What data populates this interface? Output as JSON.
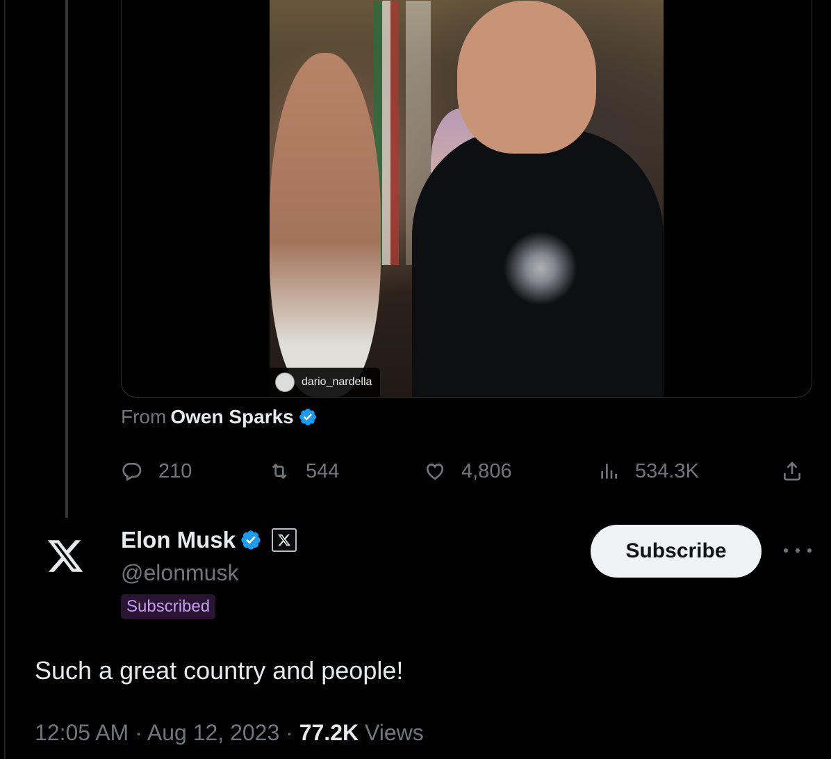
{
  "colors": {
    "background": "#000000",
    "text_primary": "#e7e9ea",
    "text_secondary": "#71767b",
    "verified_blue": "#1d9bf0",
    "subscribed_badge_text": "#c79bf2",
    "subscribed_badge_bg": "#2a1433",
    "subscribe_button_bg": "#eff3f4"
  },
  "quoted_post": {
    "video_overlay_username": "dario_nardella",
    "from_prefix": "From",
    "from_author": "Owen Sparks",
    "verified_icon": "verified-badge-icon",
    "actions": {
      "replies": "210",
      "reposts": "544",
      "likes": "4,806",
      "views": "534.3K"
    },
    "icons": {
      "reply": "reply-icon",
      "repost": "repost-icon",
      "like": "heart-icon",
      "views": "views-chart-icon",
      "share": "share-icon"
    }
  },
  "post": {
    "avatar_icon": "x-logo-icon",
    "author_name": "Elon Musk",
    "affiliation_icon": "x-affiliation-icon",
    "handle": "@elonmusk",
    "subscribed_badge": "Subscribed",
    "subscribe_button": "Subscribe",
    "more_icon": "more-options-icon",
    "text": "Such a great country and people!",
    "time": "12:05 AM",
    "date": "Aug 12, 2023",
    "separator": "·",
    "views_count": "77.2K",
    "views_label": "Views"
  }
}
